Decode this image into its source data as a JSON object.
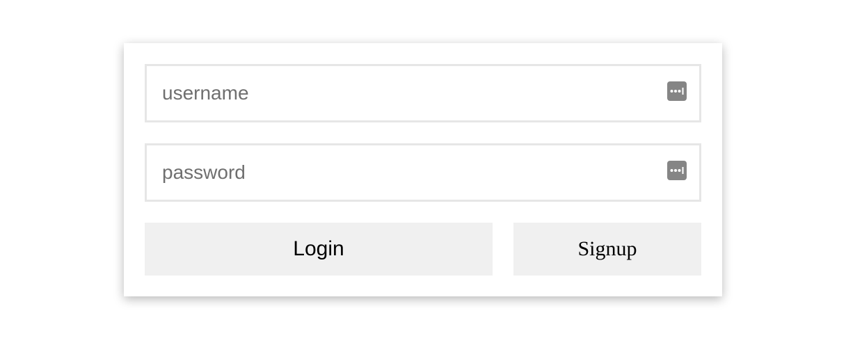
{
  "form": {
    "username": {
      "value": "",
      "placeholder": "username"
    },
    "password": {
      "value": "",
      "placeholder": "password"
    },
    "login_label": "Login",
    "signup_label": "Signup"
  },
  "icons": {
    "username_field": "password-manager-key-icon",
    "password_field": "password-manager-key-icon"
  },
  "colors": {
    "card_background": "#ffffff",
    "field_border": "#e6e6e6",
    "button_background": "#f0f0f0",
    "placeholder": "#6f6f6f",
    "icon": "#858585"
  }
}
